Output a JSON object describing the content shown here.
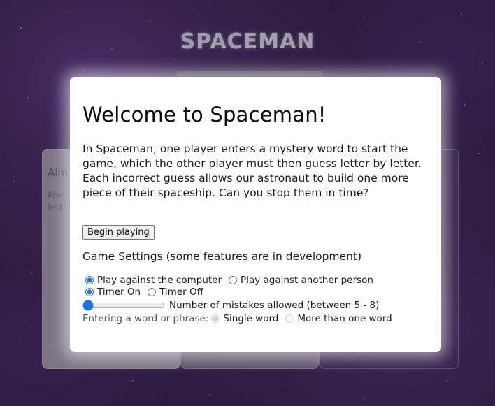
{
  "game_title": "SPACEMAN",
  "background_card": {
    "heading": "Alm",
    "text_line1": "Pre",
    "text_line2": "lett"
  },
  "modal": {
    "title": "Welcome to Spaceman!",
    "intro": "In Spaceman, one player enters a mystery word to start the game, which the other player must then guess letter by letter. Each incorrect guess allows our astronaut to build one more piece of their spaceship. Can you stop them in time?",
    "begin_button": "Begin playing",
    "settings_title": "Game Settings (some features are in development)",
    "opponent": {
      "options": [
        "Play against the computer",
        "Play against another person"
      ],
      "selected": "Play against the computer"
    },
    "timer": {
      "options": [
        "Timer On",
        "Timer Off"
      ],
      "selected": "Timer On"
    },
    "mistakes": {
      "label": "Number of mistakes allowed (between 5 - 8)",
      "min": 5,
      "max": 8,
      "value": 5
    },
    "word_entry": {
      "label": "Entering a word or phrase:",
      "options": [
        "Single word",
        "More than one word"
      ],
      "selected": "Single word",
      "disabled": true
    }
  },
  "colors": {
    "background": "#241634",
    "modal_bg": "#ffffff",
    "accent": "#1a73e8"
  }
}
